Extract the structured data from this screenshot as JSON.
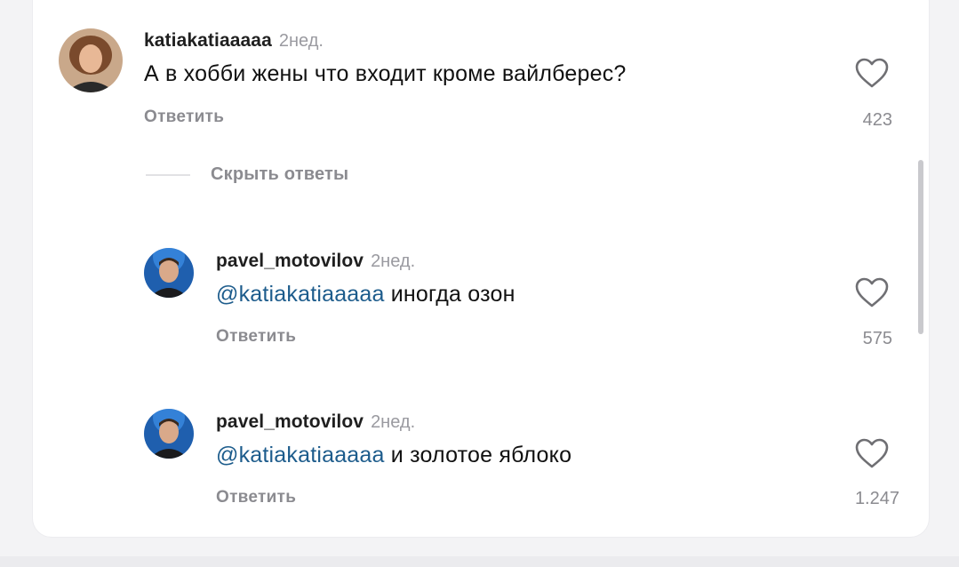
{
  "hide_replies_label": "Скрыть ответы",
  "comment": {
    "username": "katiakatiaaaaa",
    "time": "2нед.",
    "text": "А в хобби жены что входит кроме вайлберес?",
    "reply_label": "Ответить",
    "likes": "423"
  },
  "replies": [
    {
      "username": "pavel_motovilov",
      "time": "2нед.",
      "mention": "@katiakatiaaaaa",
      "text": "иногда озон",
      "reply_label": "Ответить",
      "likes": "575"
    },
    {
      "username": "pavel_motovilov",
      "time": "2нед.",
      "mention": "@katiakatiaaaaa",
      "text": "и золотое яблоко",
      "reply_label": "Ответить",
      "likes": "1.247"
    }
  ],
  "icons": {
    "avatar_main": "user-avatar-photo",
    "avatar_reply": "user-avatar-photo",
    "like": "heart-outline-icon"
  },
  "colors": {
    "mention": "#1d5c8c",
    "secondary_text": "#8b8b90",
    "primary_text": "#111111"
  }
}
